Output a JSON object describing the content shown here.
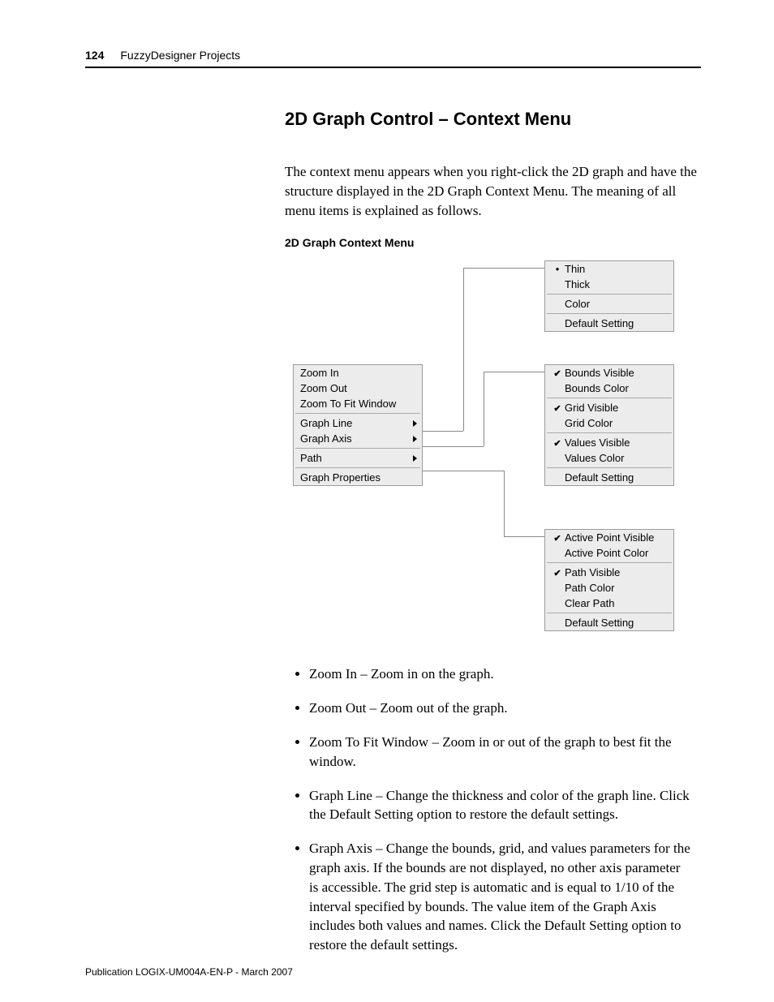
{
  "page_number": "124",
  "header_title": "FuzzyDesigner Projects",
  "section_heading": "2D Graph Control – Context Menu",
  "intro_para": "The context menu appears when you right-click the 2D graph and have the structure displayed in the 2D Graph Context Menu. The meaning of all menu items is explained as follows.",
  "figure_caption": "2D Graph Context Menu",
  "main_menu": {
    "g1": [
      "Zoom In",
      "Zoom Out",
      "Zoom To Fit Window"
    ],
    "g2": [
      "Graph Line",
      "Graph Axis"
    ],
    "g3": [
      "Path"
    ],
    "g4": [
      "Graph Properties"
    ]
  },
  "sub_line": [
    "Thin",
    "Thick",
    "Color",
    "Default Setting"
  ],
  "sub_axis": [
    "Bounds Visible",
    "Bounds Color",
    "Grid Visible",
    "Grid Color",
    "Values Visible",
    "Values Color",
    "Default Setting"
  ],
  "sub_path": [
    "Active Point Visible",
    "Active Point Color",
    "Path Visible",
    "Path Color",
    "Clear Path",
    "Default Setting"
  ],
  "defs": [
    "Zoom In – Zoom in on the graph.",
    "Zoom Out – Zoom out of the graph.",
    "Zoom To Fit Window – Zoom in or out of the graph to best fit the window.",
    "Graph Line – Change the thickness and color of the graph line. Click the Default Setting option to restore the default settings.",
    "Graph Axis – Change the bounds, grid, and values parameters for the graph axis. If the bounds are not displayed, no other axis parameter is accessible. The grid step is automatic and is equal to 1/10 of the interval specified by bounds. The value item of the Graph Axis includes both values and names. Click the Default Setting option to restore the default settings."
  ],
  "footer": "Publication LOGIX-UM004A-EN-P - March 2007"
}
